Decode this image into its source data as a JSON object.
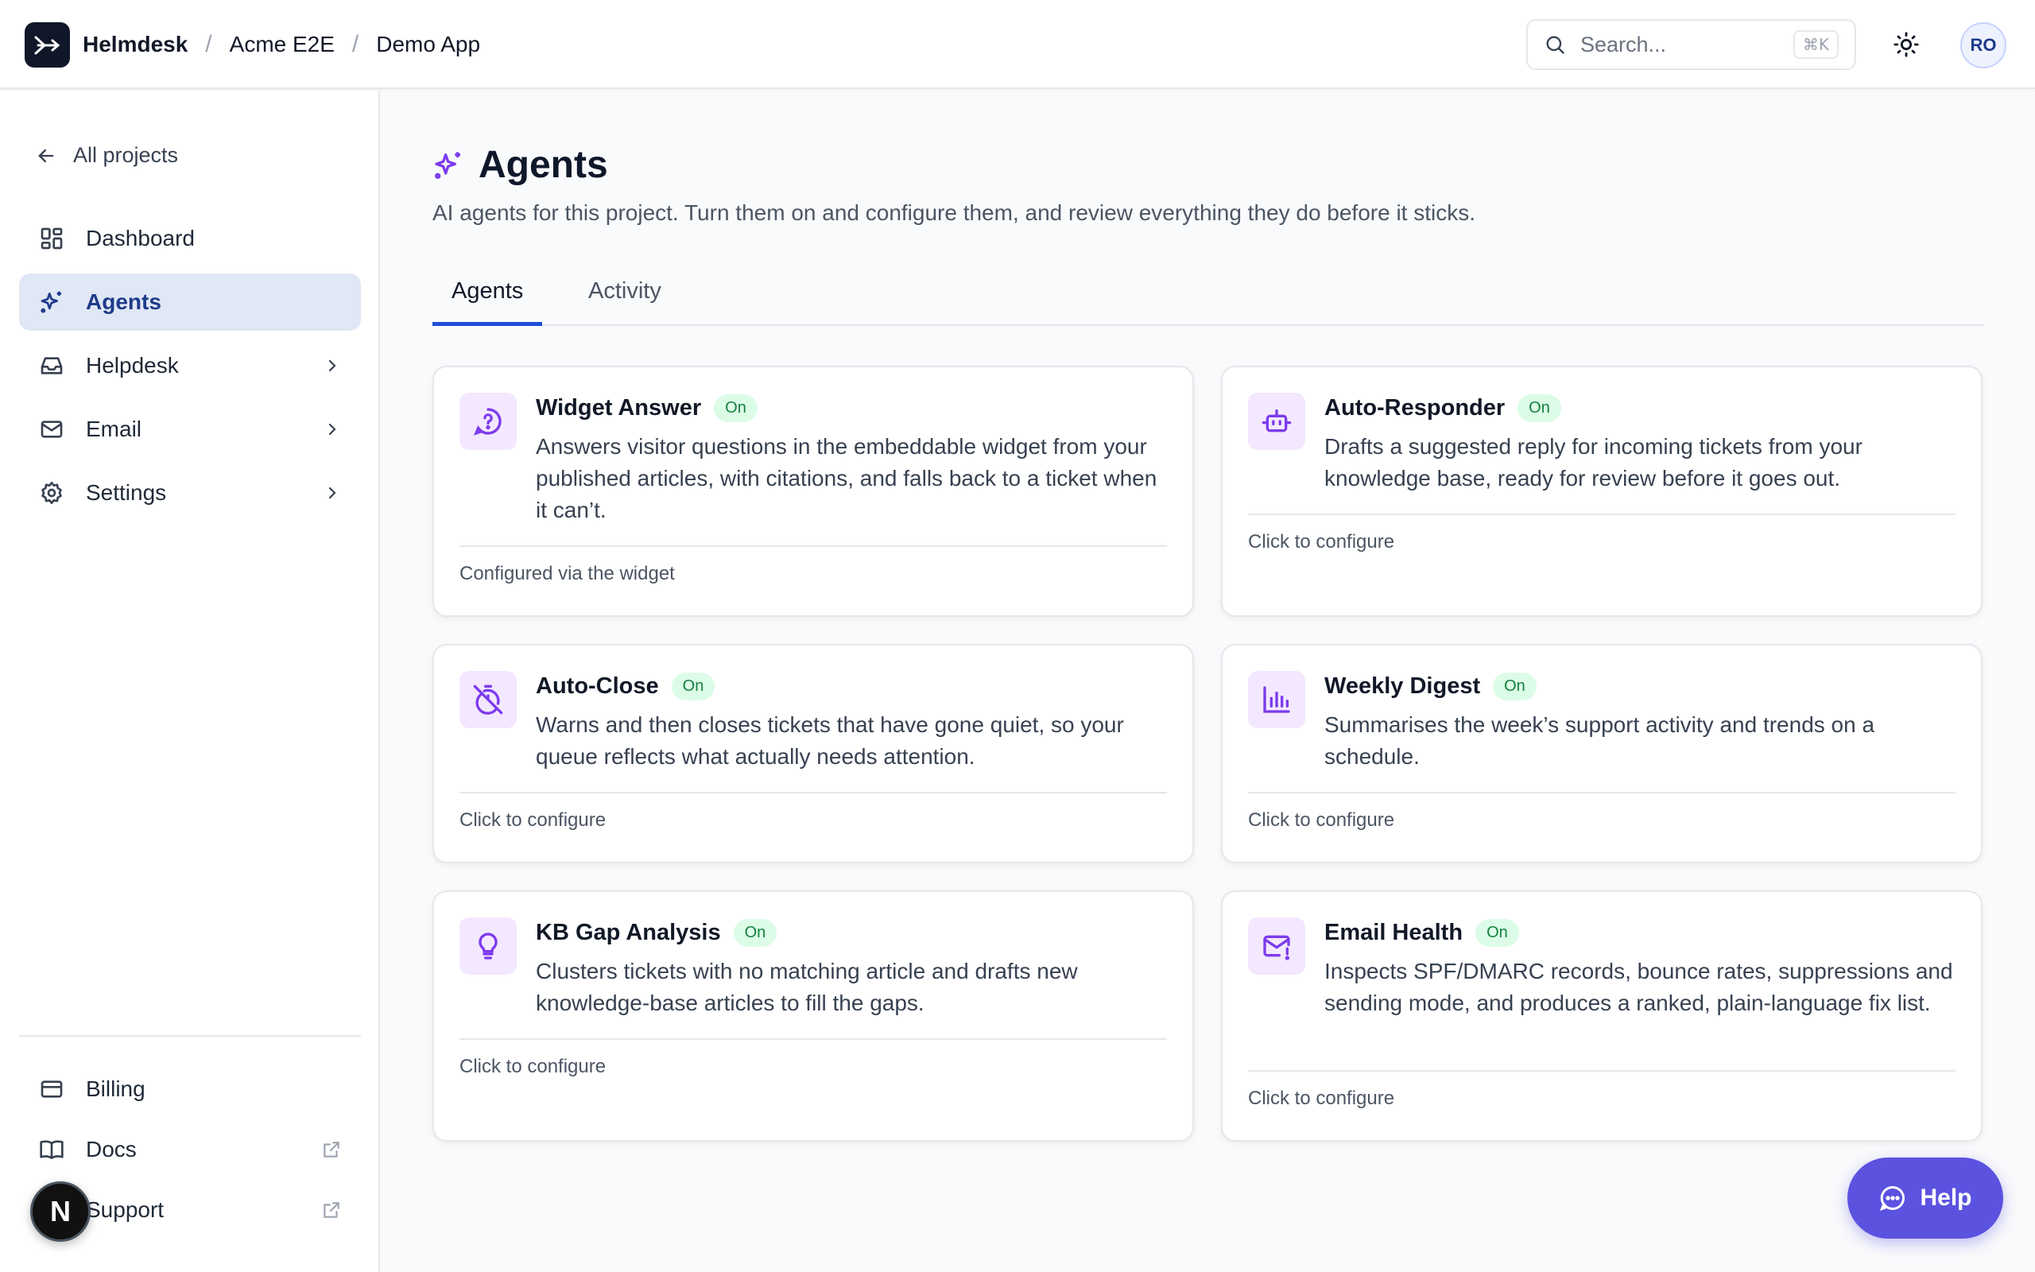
{
  "header": {
    "app_name": "Helmdesk",
    "breadcrumbs": [
      "Acme E2E",
      "Demo App"
    ],
    "separator": "/",
    "search_placeholder": "Search...",
    "search_shortcut": "⌘K",
    "avatar_initials": "RO"
  },
  "sidebar": {
    "back_label": "All projects",
    "items": [
      {
        "label": "Dashboard",
        "icon": "dashboard-icon"
      },
      {
        "label": "Agents",
        "icon": "sparkles-icon",
        "active": true
      },
      {
        "label": "Helpdesk",
        "icon": "inbox-icon",
        "has_children": true
      },
      {
        "label": "Email",
        "icon": "mail-icon",
        "has_children": true
      },
      {
        "label": "Settings",
        "icon": "gear-icon",
        "has_children": true
      }
    ],
    "footer_items": [
      {
        "label": "Billing",
        "icon": "credit-card-icon"
      },
      {
        "label": "Docs",
        "icon": "book-icon",
        "external": true
      },
      {
        "label": "Support",
        "icon": "support-icon",
        "external": true
      }
    ],
    "dev_badge": "N"
  },
  "page": {
    "title": "Agents",
    "subtitle": "AI agents for this project. Turn them on and configure them, and review everything they do before it sticks.",
    "tabs": [
      "Agents",
      "Activity"
    ],
    "active_tab": "Agents"
  },
  "agents": [
    {
      "name": "Widget Answer",
      "status": "On",
      "icon": "question-bubble-icon",
      "description": "Answers visitor questions in the embeddable widget from your published articles, with citations, and falls back to a ticket when it can’t.",
      "footer": "Configured via the widget"
    },
    {
      "name": "Auto-Responder",
      "status": "On",
      "icon": "robot-icon",
      "description": "Drafts a suggested reply for incoming tickets from your knowledge base, ready for review before it goes out.",
      "footer": "Click to configure"
    },
    {
      "name": "Auto-Close",
      "status": "On",
      "icon": "timer-off-icon",
      "description": "Warns and then closes tickets that have gone quiet, so your queue reflects what actually needs attention.",
      "footer": "Click to configure"
    },
    {
      "name": "Weekly Digest",
      "status": "On",
      "icon": "bar-chart-icon",
      "description": "Summarises the week’s support activity and trends on a schedule.",
      "footer": "Click to configure"
    },
    {
      "name": "KB Gap Analysis",
      "status": "On",
      "icon": "lightbulb-icon",
      "description": "Clusters tickets with no matching article and drafts new knowledge-base articles to fill the gaps.",
      "footer": "Click to configure"
    },
    {
      "name": "Email Health",
      "status": "On",
      "icon": "mail-alert-icon",
      "description": "Inspects SPF/DMARC records, bounce rates, suppressions and sending mode, and produces a ranked, plain-language fix list.",
      "footer": "Click to configure"
    }
  ],
  "help_button": {
    "label": "Help"
  },
  "colors": {
    "accent": "#1d4ed8",
    "agent_icon": "#7c3aed",
    "on_badge_bg": "#dcfce7",
    "on_badge_text": "#15803d",
    "help_bg": "#5b52e0"
  }
}
